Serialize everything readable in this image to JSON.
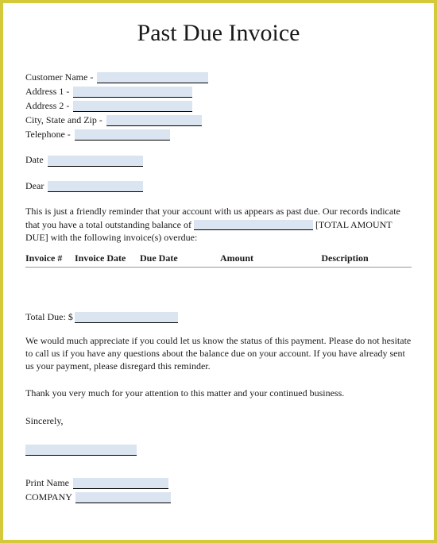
{
  "title": "Past Due Invoice",
  "fields": {
    "customer_name": "Customer Name - ",
    "address1": "Address 1 - ",
    "address2": "Address 2 - ",
    "city_state_zip": "City, State and Zip - ",
    "telephone": "Telephone - ",
    "date": "Date ",
    "dear": "Dear "
  },
  "body": {
    "p1_a": "This is just a friendly reminder that your account with us appears as past due. Our records indicate that you have a total outstanding balance of ",
    "p1_b": " [TOTAL AMOUNT DUE] with the following invoice(s) overdue:"
  },
  "table": {
    "h1": "Invoice #",
    "h2": "Invoice Date",
    "h3": "Due Date",
    "h4": "Amount",
    "h5": "Description"
  },
  "total_due_label": "Total Due: $",
  "body2": {
    "p2": "We would much appreciate if you could let us know the status of this payment. Please do not hesitate to call us if you have any questions about the balance due on your account. If you have already sent us your payment, please disregard this reminder.",
    "p3": "Thank you very much for your attention to this matter and your continued business.",
    "sincerely": "Sincerely,",
    "print_name": "Print Name ",
    "company": "COMPANY "
  }
}
